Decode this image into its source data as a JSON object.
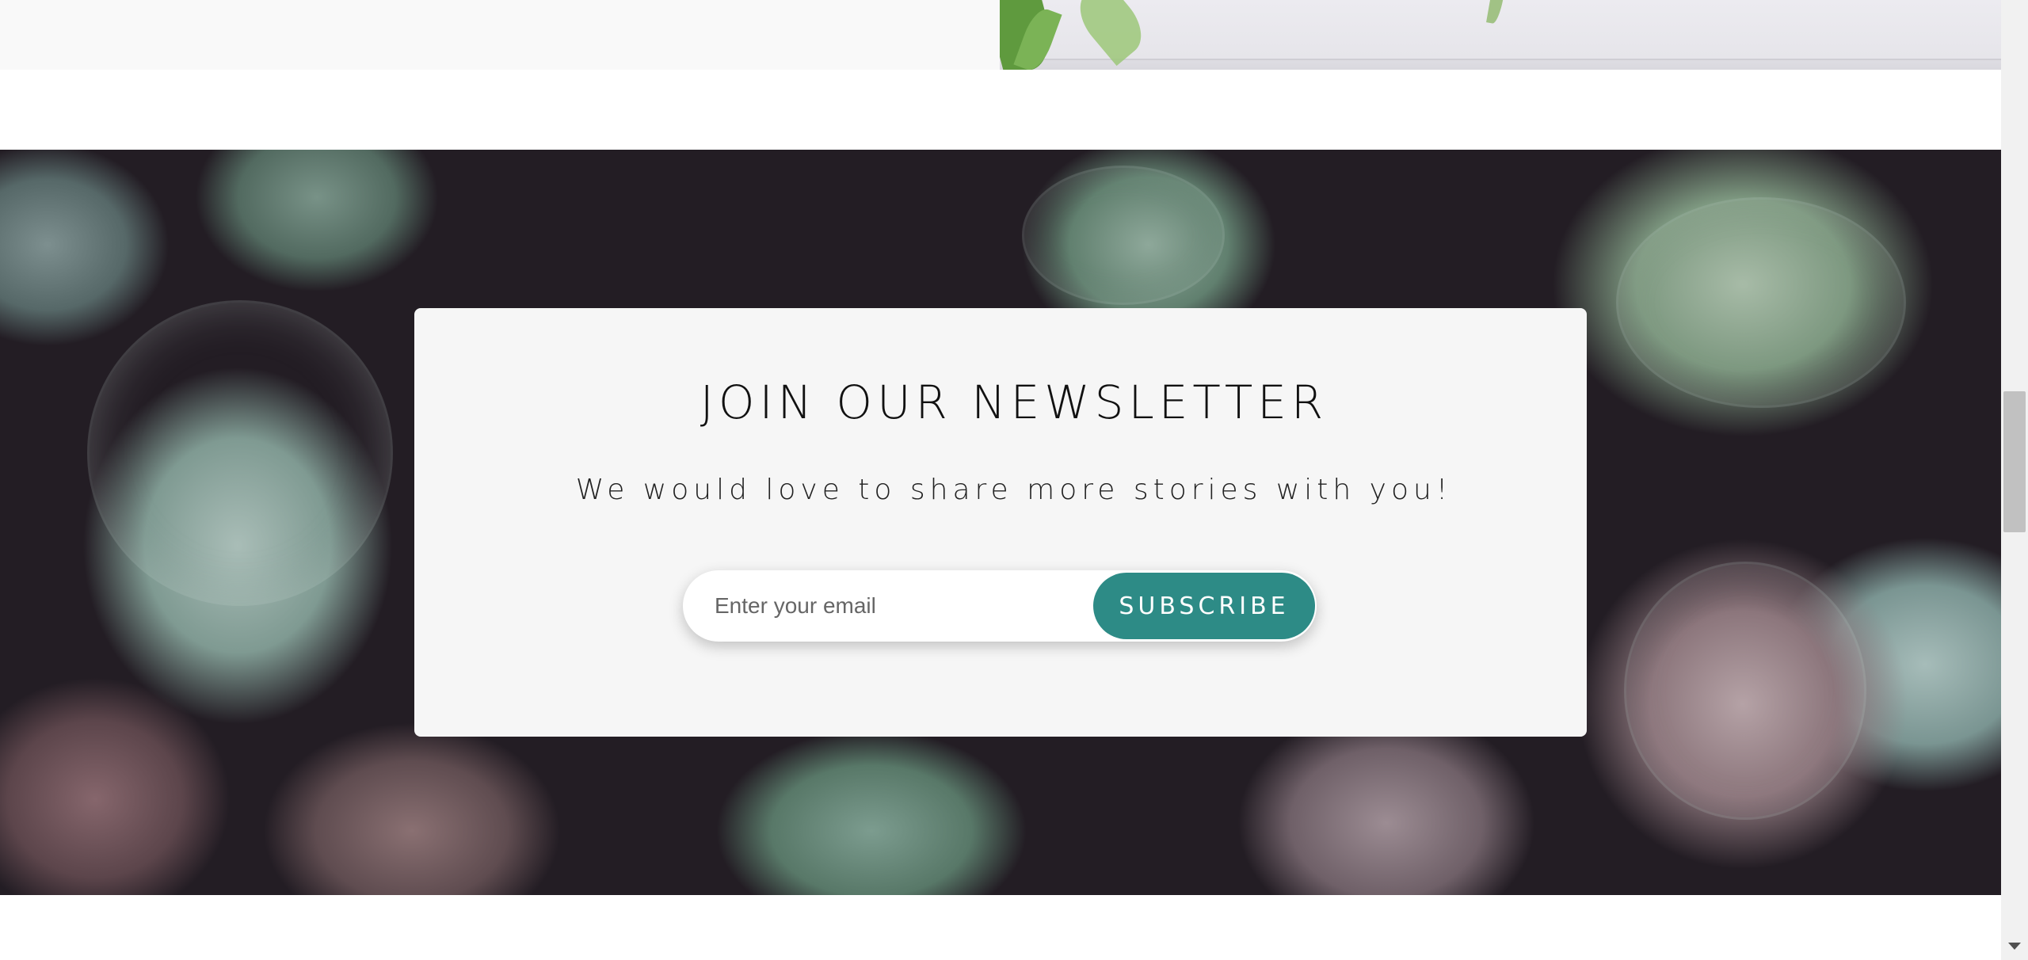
{
  "newsletter": {
    "title": "JOIN OUR NEWSLETTER",
    "subtitle": "We would love to share more stories with you!",
    "email_placeholder": "Enter your email",
    "subscribe_label": "SUBSCRIBE"
  },
  "colors": {
    "accent": "#2d8b86",
    "card_background": "#f6f6f6",
    "hero_background": "#231d24"
  },
  "icons": {
    "scroll_down": "chevron-down-icon"
  }
}
